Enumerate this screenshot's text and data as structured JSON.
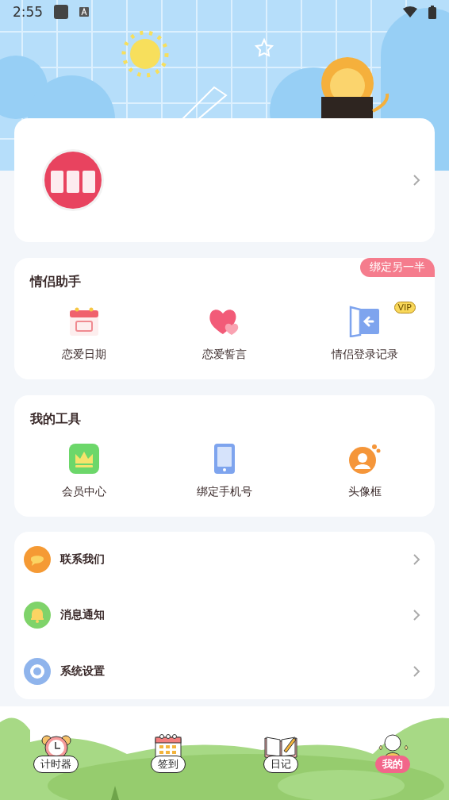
{
  "status_bar": {
    "time": "2:55"
  },
  "couple_assistant": {
    "title": "情侣助手",
    "badge": "绑定另一半",
    "items": [
      {
        "kind": "calendar",
        "label": "恋爱日期"
      },
      {
        "kind": "hearts",
        "label": "恋爱誓言"
      },
      {
        "kind": "door",
        "label": "情侣登录记录",
        "tag": "VIP"
      }
    ]
  },
  "my_tools": {
    "title": "我的工具",
    "items": [
      {
        "kind": "crown",
        "label": "会员中心"
      },
      {
        "kind": "phone",
        "label": "绑定手机号"
      },
      {
        "kind": "frame",
        "label": "头像框"
      }
    ]
  },
  "menu": [
    {
      "kind": "chat",
      "label": "联系我们",
      "color": "#f59a34"
    },
    {
      "kind": "bell",
      "label": "消息通知",
      "color": "#7fd36a"
    },
    {
      "kind": "gear",
      "label": "系统设置",
      "color": "#8fb4ec"
    }
  ],
  "tabs": [
    {
      "kind": "clock",
      "label": "计时器",
      "selected": false
    },
    {
      "kind": "calendar",
      "label": "签到",
      "selected": false
    },
    {
      "kind": "book",
      "label": "日记",
      "selected": false
    },
    {
      "kind": "person",
      "label": "我的",
      "selected": true
    }
  ]
}
